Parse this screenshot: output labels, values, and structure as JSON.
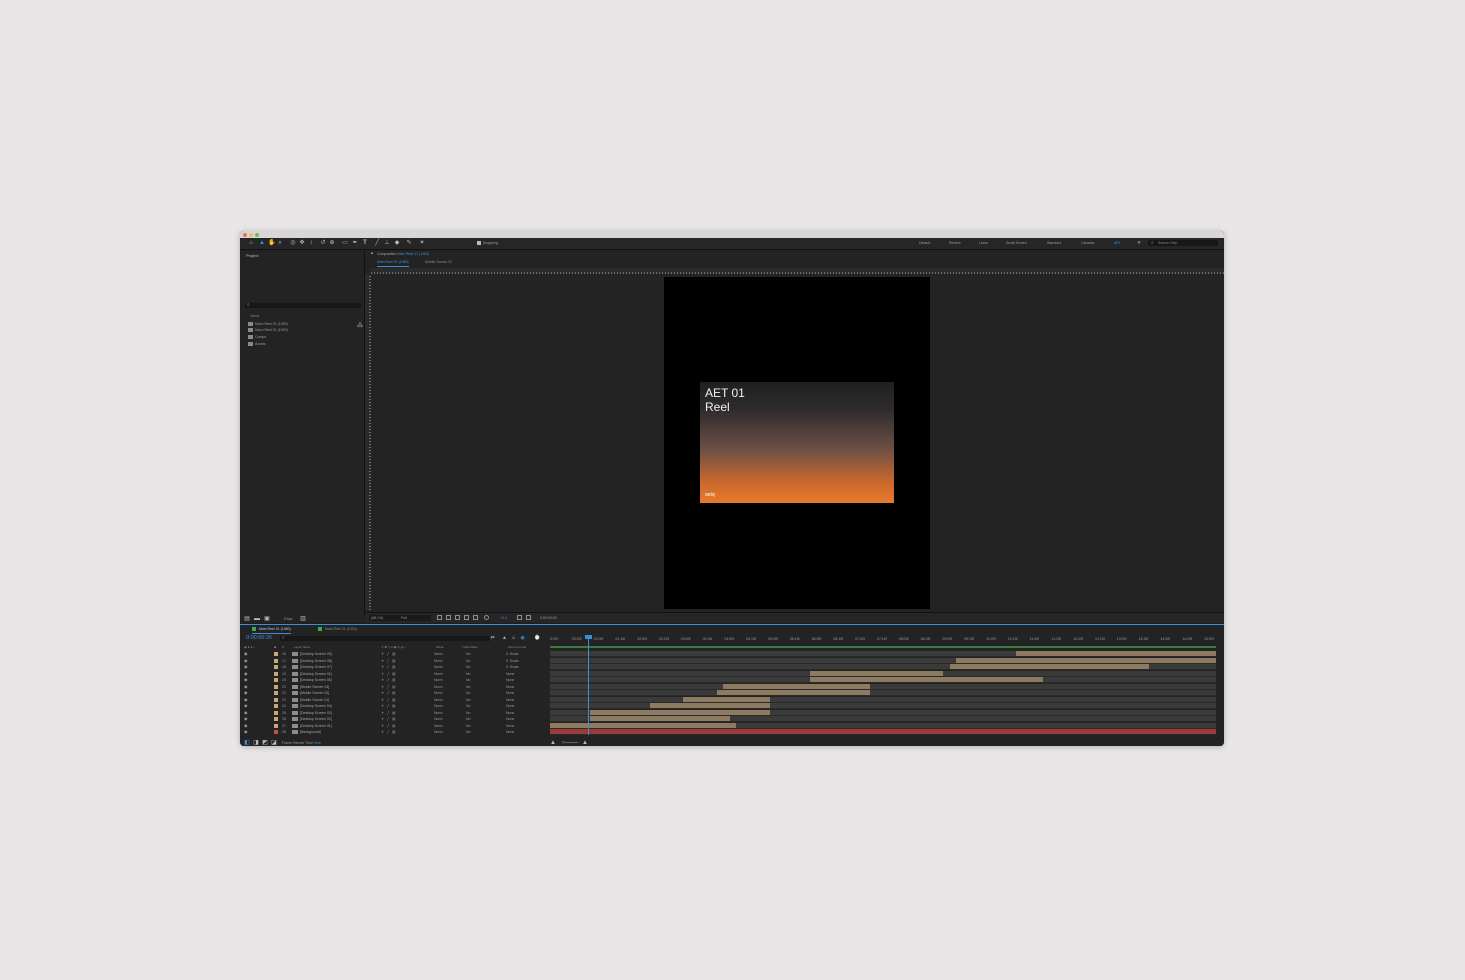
{
  "workspaces": [
    "Default",
    "Review",
    "Learn",
    "Small Screen",
    "Standard",
    "Libraries",
    "AET"
  ],
  "toolbar": {
    "snapping_label": "Snapping",
    "search_placeholder": "Search Help"
  },
  "project": {
    "title": "Project",
    "col_name": "Name",
    "items": [
      {
        "label": "Micro Reel 01 (1080)"
      },
      {
        "label": "Micro Reel 01 (1920)"
      },
      {
        "label": "Comps"
      },
      {
        "label": "Assets"
      }
    ],
    "bpc": "8 bpc"
  },
  "composition": {
    "header_prefix": "Composition",
    "header_name": "Main Reel 01 (1080)",
    "tabs": [
      "Main Reel 01 (1080)",
      "Mobile Screen 01"
    ],
    "frame": {
      "title_line1": "AET 01",
      "title_line2": "Reel",
      "logo": "aetq"
    },
    "zoom": "(48.1%)",
    "quality": "Full",
    "timecode": "0:00:00:26",
    "exposure": "+0.0"
  },
  "timeline": {
    "tabs": [
      "Main Reel 01 (1080)",
      "Main Reel 01 (1920)"
    ],
    "current_time": "0:00:00:26",
    "columns": {
      "layer_name": "Layer Name",
      "mode": "Mode",
      "trkmat": "Track Matte",
      "parent": "Parent & Link"
    },
    "layers": [
      {
        "num": "16",
        "name": "[Desktop Screen 09]",
        "mode": "Norm",
        "matte": "No",
        "parent": "3. Scale",
        "label_color": "#c9a878"
      },
      {
        "num": "17",
        "name": "[Desktop Screen 08]",
        "mode": "Norm",
        "matte": "No",
        "parent": "3. Scale",
        "label_color": "#c9a878"
      },
      {
        "num": "18",
        "name": "[Desktop Screen 07]",
        "mode": "Norm",
        "matte": "No",
        "parent": "3. Scale",
        "label_color": "#c9a878"
      },
      {
        "num": "19",
        "name": "[Desktop Screen 01]",
        "mode": "Norm",
        "matte": "No",
        "parent": "None",
        "label_color": "#c9a878"
      },
      {
        "num": "20",
        "name": "[Desktop Screen 06]",
        "mode": "Norm",
        "matte": "No",
        "parent": "None",
        "label_color": "#c9a878"
      },
      {
        "num": "21",
        "name": "[Mobile Screen 03]",
        "mode": "Norm",
        "matte": "No",
        "parent": "None",
        "label_color": "#c9a878"
      },
      {
        "num": "22",
        "name": "[Mobile Screen 02]",
        "mode": "Norm",
        "matte": "No",
        "parent": "None",
        "label_color": "#c9a878"
      },
      {
        "num": "23",
        "name": "[Mobile Screen 01]",
        "mode": "Norm",
        "matte": "No",
        "parent": "None",
        "label_color": "#c9a878"
      },
      {
        "num": "24",
        "name": "[Desktop Screen 04]",
        "mode": "Norm",
        "matte": "No",
        "parent": "None",
        "label_color": "#c9a878"
      },
      {
        "num": "25",
        "name": "[Desktop Screen 03]",
        "mode": "Norm",
        "matte": "No",
        "parent": "None",
        "label_color": "#c9a878"
      },
      {
        "num": "26",
        "name": "[Desktop Screen 02]",
        "mode": "Norm",
        "matte": "No",
        "parent": "None",
        "label_color": "#c9a878"
      },
      {
        "num": "27",
        "name": "[Desktop Screen 01]",
        "mode": "Norm",
        "matte": "No",
        "parent": "None",
        "label_color": "#c9a878"
      },
      {
        "num": "28",
        "name": "[Background]",
        "mode": "Norm",
        "matte": "No",
        "parent": "None",
        "label_color": "#c94a4a"
      }
    ],
    "frame_render_label": "Frame Render Time",
    "frame_render_value": "0ms",
    "ruler_ticks": [
      "0:00f",
      "00:15f",
      "01:00f",
      "01:15f",
      "02:00f",
      "02:15f",
      "03:00f",
      "03:15f",
      "04:00f",
      "04:15f",
      "05:00f",
      "05:15f",
      "06:00f",
      "06:15f",
      "07:00f",
      "07:15f",
      "08:00f",
      "08:15f",
      "09:00f",
      "09:15f",
      "10:00f",
      "10:15f",
      "11:00f",
      "11:15f",
      "12:00f",
      "12:15f",
      "13:00f",
      "13:15f",
      "14:00f",
      "14:15f",
      "15:00f"
    ],
    "clip_color": "#8c7b60",
    "bg_clip_color": "#9a3a3a"
  }
}
